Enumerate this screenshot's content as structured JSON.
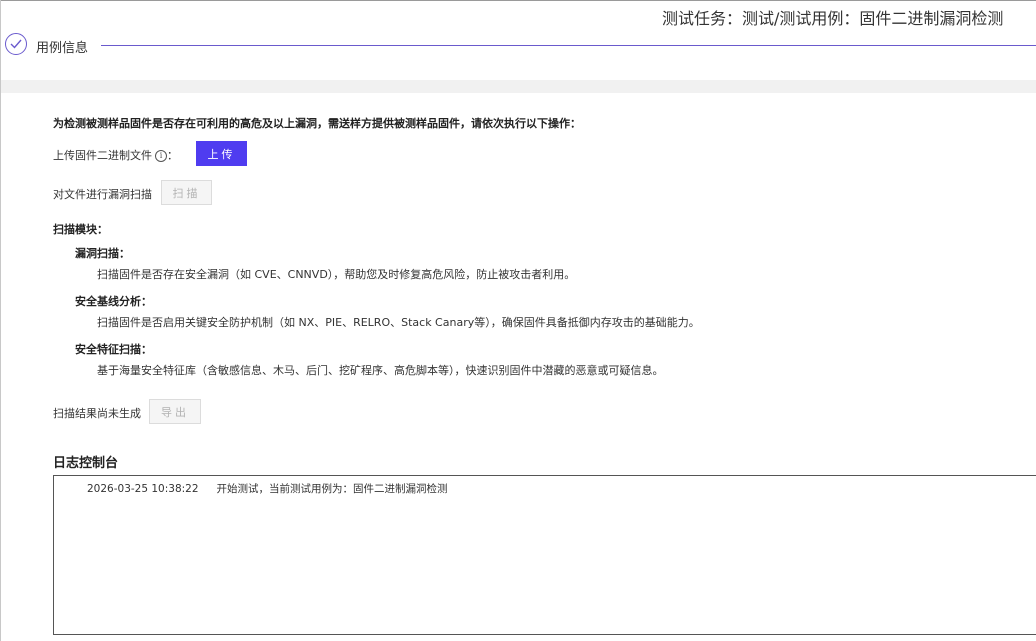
{
  "header": {
    "task_title": "测试任务：测试/测试用例：固件二进制漏洞检测",
    "step_label": "用例信息",
    "accent_color": "#6a5acd"
  },
  "instructions": {
    "intro": "为检测被测样品固件是否存在可利用的高危及以上漏洞，需送样方提供被测样品固件，请依次执行以下操作：",
    "upload_label": "上传固件二进制文件",
    "upload_colon": "：",
    "info_icon": "i",
    "upload_button": "上传",
    "scan_label": "对文件进行漏洞扫描",
    "scan_button": "扫描"
  },
  "modules": {
    "title": "扫描模块：",
    "items": [
      {
        "title": "漏洞扫描：",
        "desc": "扫描固件是否存在安全漏洞（如 CVE、CNNVD），帮助您及时修复高危风险，防止被攻击者利用。"
      },
      {
        "title": "安全基线分析：",
        "desc": "扫描固件是否启用关键安全防护机制（如 NX、PIE、RELRO、Stack Canary等），确保固件具备抵御内存攻击的基础能力。"
      },
      {
        "title": "安全特征扫描：",
        "desc": "基于海量安全特征库（含敏感信息、木马、后门、挖矿程序、高危脚本等），快速识别固件中潜藏的恶意或可疑信息。"
      }
    ]
  },
  "export": {
    "status": "扫描结果尚未生成",
    "button": "导出"
  },
  "log": {
    "title": "日志控制台",
    "entries": [
      {
        "time": "2026-03-25 10:38:22",
        "message": "开始测试，当前测试用例为：固件二进制漏洞检测"
      }
    ]
  }
}
